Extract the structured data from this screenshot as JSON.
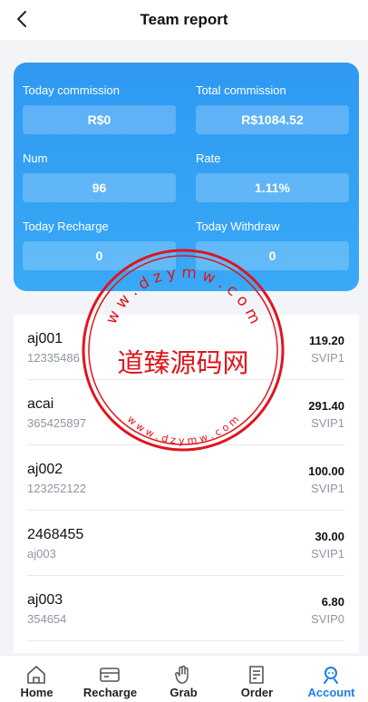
{
  "header": {
    "title": "Team report"
  },
  "stats": {
    "today_commission": {
      "label": "Today commission",
      "value": "R$0"
    },
    "total_commission": {
      "label": "Total commission",
      "value": "R$1084.52"
    },
    "num": {
      "label": "Num",
      "value": "96"
    },
    "rate": {
      "label": "Rate",
      "value": "1.11%"
    },
    "today_recharge": {
      "label": "Today Recharge",
      "value": "0"
    },
    "today_withdraw": {
      "label": "Today Withdraw",
      "value": "0"
    }
  },
  "members": [
    {
      "name": "aj001",
      "sub": "12335486",
      "amount": "119.20",
      "level": "SVIP1"
    },
    {
      "name": "acai",
      "sub": "365425897",
      "amount": "291.40",
      "level": "SVIP1"
    },
    {
      "name": "aj002",
      "sub": "123252122",
      "amount": "100.00",
      "level": "SVIP1"
    },
    {
      "name": "2468455",
      "sub": "aj003",
      "amount": "30.00",
      "level": "SVIP1"
    },
    {
      "name": "aj003",
      "sub": "354654",
      "amount": "6.80",
      "level": "SVIP0"
    }
  ],
  "tabs": [
    {
      "label": "Home",
      "icon": "home-icon"
    },
    {
      "label": "Recharge",
      "icon": "card-icon"
    },
    {
      "label": "Grab",
      "icon": "hand-icon"
    },
    {
      "label": "Order",
      "icon": "order-icon"
    },
    {
      "label": "Account",
      "icon": "user-icon",
      "active": true
    }
  ],
  "stamp": {
    "top_text": "w w . d z y m w . c o m",
    "center_text": "道臻源码网",
    "bottom_text": "w w w . d z y m w . c o m"
  },
  "colors": {
    "accent": "#1a7cf0",
    "card_top": "#2f99f3",
    "card_bottom": "#39a9f6",
    "stamp": "#e0141c"
  }
}
